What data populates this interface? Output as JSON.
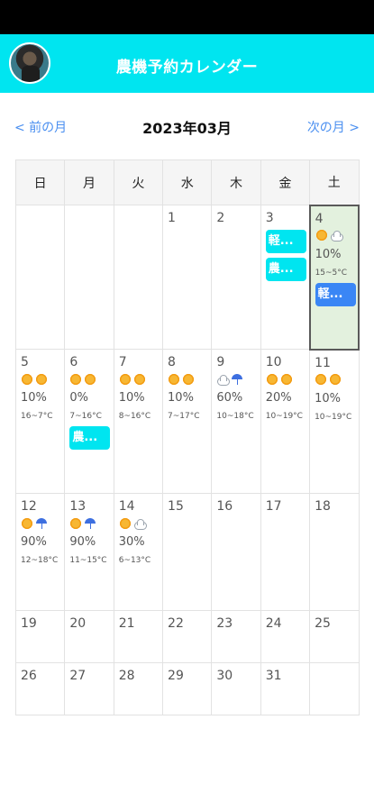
{
  "app": {
    "title": "農機予約カレンダー"
  },
  "nav": {
    "prev_label": "< 前の月",
    "next_label": "次の月 >",
    "month_title": "2023年03月"
  },
  "calendar": {
    "weekdays": [
      "日",
      "月",
      "火",
      "水",
      "木",
      "金",
      "土"
    ],
    "days": {
      "d1": {
        "num": "1"
      },
      "d2": {
        "num": "2"
      },
      "d3": {
        "num": "3",
        "events": [
          "軽...",
          "農..."
        ]
      },
      "d4": {
        "num": "4",
        "weather": [
          "sun-icon",
          "cloud-icon"
        ],
        "rain": "10%",
        "temp": "15~5°C",
        "events": [
          "軽..."
        ]
      },
      "d5": {
        "num": "5",
        "weather": [
          "sun-icon",
          "sun-icon"
        ],
        "rain": "10%",
        "temp": "16~7°C"
      },
      "d6": {
        "num": "6",
        "weather": [
          "sun-icon",
          "sun-icon"
        ],
        "rain": "0%",
        "temp": "7~16°C",
        "events": [
          "農..."
        ]
      },
      "d7": {
        "num": "7",
        "weather": [
          "sun-icon",
          "sun-icon"
        ],
        "rain": "10%",
        "temp": "8~16°C"
      },
      "d8": {
        "num": "8",
        "weather": [
          "sun-icon",
          "sun-icon"
        ],
        "rain": "10%",
        "temp": "7~17°C"
      },
      "d9": {
        "num": "9",
        "weather": [
          "cloud-icon",
          "umbrella-icon"
        ],
        "rain": "60%",
        "temp": "10~18°C"
      },
      "d10": {
        "num": "10",
        "weather": [
          "sun-icon",
          "sun-icon"
        ],
        "rain": "20%",
        "temp": "10~19°C"
      },
      "d11": {
        "num": "11",
        "weather": [
          "sun-icon",
          "sun-icon"
        ],
        "rain": "10%",
        "temp": "10~19°C"
      },
      "d12": {
        "num": "12",
        "weather": [
          "sun-icon",
          "umbrella-icon"
        ],
        "rain": "90%",
        "temp": "12~18°C"
      },
      "d13": {
        "num": "13",
        "weather": [
          "sun-icon",
          "umbrella-icon"
        ],
        "rain": "90%",
        "temp": "11~15°C"
      },
      "d14": {
        "num": "14",
        "weather": [
          "sun-icon",
          "cloud-icon"
        ],
        "rain": "30%",
        "temp": "6~13°C"
      },
      "d15": {
        "num": "15"
      },
      "d16": {
        "num": "16"
      },
      "d17": {
        "num": "17"
      },
      "d18": {
        "num": "18"
      },
      "d19": {
        "num": "19"
      },
      "d20": {
        "num": "20"
      },
      "d21": {
        "num": "21"
      },
      "d22": {
        "num": "22"
      },
      "d23": {
        "num": "23"
      },
      "d24": {
        "num": "24"
      },
      "d25": {
        "num": "25"
      },
      "d26": {
        "num": "26"
      },
      "d27": {
        "num": "27"
      },
      "d28": {
        "num": "28"
      },
      "d29": {
        "num": "29"
      },
      "d30": {
        "num": "30"
      },
      "d31": {
        "num": "31"
      }
    }
  },
  "colors": {
    "header": "#00e5f0",
    "accent_link": "#4a8ff0",
    "event_cyan": "#00e5f0",
    "event_blue": "#3a86f5",
    "selected_bg": "#e3f1de"
  }
}
